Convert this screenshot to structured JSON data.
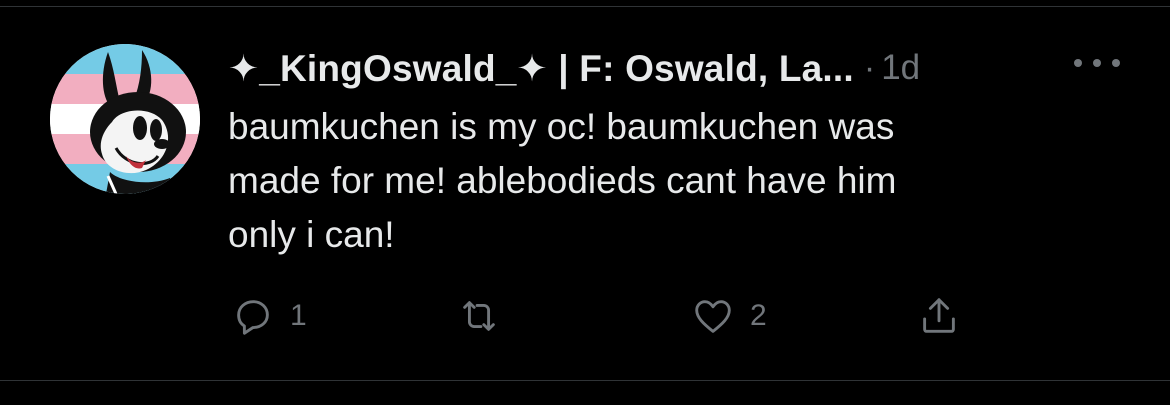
{
  "tweet": {
    "display_name": "✦_KingOswald_✦ | F: Oswald, La...",
    "separator": "·",
    "timestamp": "1d",
    "text_lines": [
      "baumkuchen is my oc! baumkuchen was",
      "made for me! ablebodieds cant have him",
      "only i can!"
    ],
    "avatar_icon": "profile-avatar",
    "more_icon": "more-options-icon"
  },
  "actions": {
    "reply": {
      "icon": "reply-icon",
      "count": "1"
    },
    "retweet": {
      "icon": "retweet-icon"
    },
    "like": {
      "icon": "heart-icon",
      "count": "2"
    },
    "share": {
      "icon": "share-icon"
    }
  },
  "colors": {
    "background": "#000000",
    "text_primary": "#e7e9ea",
    "text_secondary": "#71767b",
    "divider": "#2f3336",
    "trans_blue": "#74cbe6",
    "trans_pink": "#f2aec0"
  }
}
